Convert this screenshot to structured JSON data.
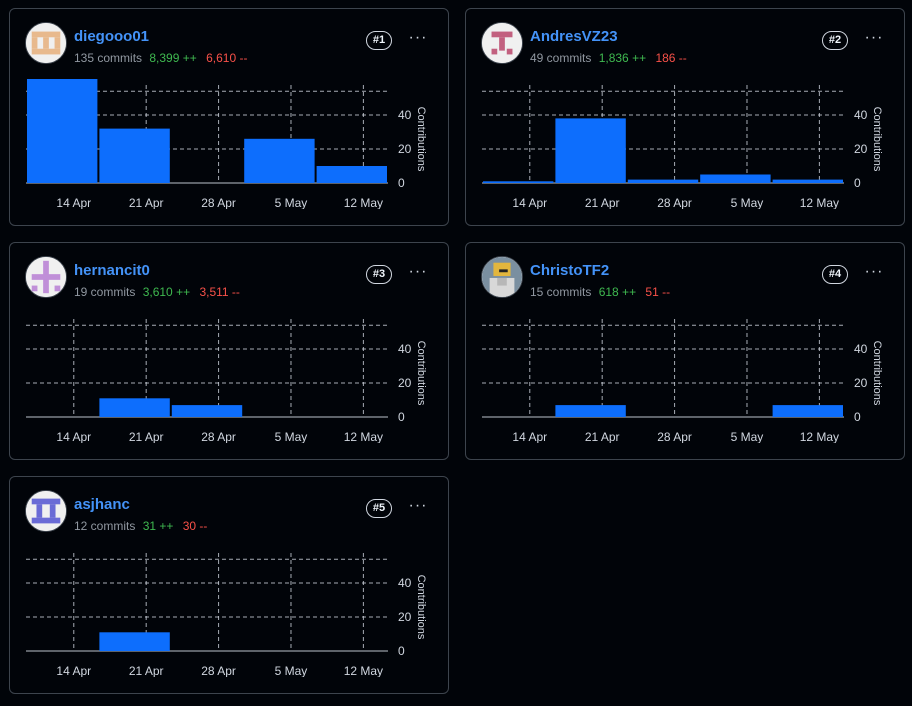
{
  "theme": {
    "bar_color": "#0d6efd",
    "grid_color": "#d1d7e0",
    "add_color": "#3fb950",
    "del_color": "#f85149",
    "link_color": "#4493f8"
  },
  "menu_glyph": "···",
  "contributors": [
    {
      "username": "diegooo01",
      "commits": "135 commits",
      "additions": "8,399 ++",
      "deletions": "6,610 --",
      "rank": "#1",
      "avatar": {
        "type": "identicon-h",
        "color": "#e8b98d"
      },
      "chart_data": {
        "type": "bar",
        "ylabel": "Contributions",
        "x_ticks": [
          "14 Apr",
          "21 Apr",
          "28 Apr",
          "5 May",
          "12 May"
        ],
        "y_ticks": [
          "0",
          "20",
          "40"
        ],
        "ylim": [
          0,
          60
        ],
        "grid": true,
        "values": [
          66,
          32,
          0,
          26,
          10
        ]
      }
    },
    {
      "username": "AndresVZ23",
      "commits": "49 commits",
      "additions": "1,836 ++",
      "deletions": "186 --",
      "rank": "#2",
      "avatar": {
        "type": "identicon-t",
        "color": "#c2607f"
      },
      "chart_data": {
        "type": "bar",
        "ylabel": "Contributions",
        "x_ticks": [
          "14 Apr",
          "21 Apr",
          "28 Apr",
          "5 May",
          "12 May"
        ],
        "y_ticks": [
          "0",
          "20",
          "40"
        ],
        "ylim": [
          0,
          60
        ],
        "grid": true,
        "values": [
          1,
          38,
          2,
          5,
          2
        ]
      }
    },
    {
      "username": "hernancit0",
      "commits": "19 commits",
      "additions": "3,610 ++",
      "deletions": "3,511 --",
      "rank": "#3",
      "avatar": {
        "type": "identicon-plus",
        "color": "#c08fd8"
      },
      "chart_data": {
        "type": "bar",
        "ylabel": "Contributions",
        "x_ticks": [
          "14 Apr",
          "21 Apr",
          "28 Apr",
          "5 May",
          "12 May"
        ],
        "y_ticks": [
          "0",
          "20",
          "40"
        ],
        "ylim": [
          0,
          60
        ],
        "grid": true,
        "values": [
          0,
          11,
          7,
          0,
          0
        ]
      }
    },
    {
      "username": "ChristoTF2",
      "commits": "15 commits",
      "additions": "618 ++",
      "deletions": "51 --",
      "rank": "#4",
      "avatar": {
        "type": "photo",
        "color": "#d9b44a"
      },
      "chart_data": {
        "type": "bar",
        "ylabel": "Contributions",
        "x_ticks": [
          "14 Apr",
          "21 Apr",
          "28 Apr",
          "5 May",
          "12 May"
        ],
        "y_ticks": [
          "0",
          "20",
          "40"
        ],
        "ylim": [
          0,
          60
        ],
        "grid": true,
        "values": [
          0,
          7,
          0,
          0,
          7
        ]
      }
    },
    {
      "username": "asjhanc",
      "commits": "12 commits",
      "additions": "31 ++",
      "deletions": "30 --",
      "rank": "#5",
      "avatar": {
        "type": "identicon-grid",
        "color": "#6a6bd6"
      },
      "chart_data": {
        "type": "bar",
        "ylabel": "Contributions",
        "x_ticks": [
          "14 Apr",
          "21 Apr",
          "28 Apr",
          "5 May",
          "12 May"
        ],
        "y_ticks": [
          "0",
          "20",
          "40"
        ],
        "ylim": [
          0,
          60
        ],
        "grid": true,
        "values": [
          0,
          11,
          0,
          0,
          0
        ]
      }
    }
  ]
}
